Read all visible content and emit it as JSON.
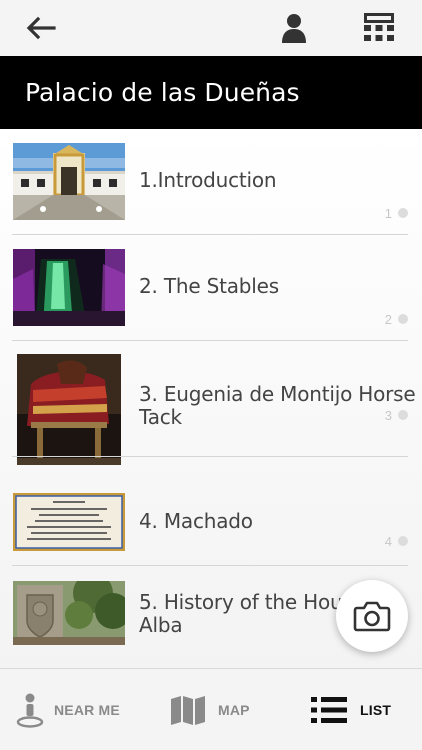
{
  "header": {
    "back_icon": "arrow-left-icon",
    "profile_icon": "user-icon",
    "keypad_icon": "keypad-icon"
  },
  "title": "Palacio de las Dueñas",
  "stops": [
    {
      "label": "1.Introduction",
      "number": "1",
      "thumb": "courtyard-gate"
    },
    {
      "label": "2. The Stables",
      "number": "2",
      "thumb": "green-lit-stables"
    },
    {
      "label": "3. Eugenia de Montijo Horse Tack",
      "number": "3",
      "thumb": "saddle"
    },
    {
      "label": "4. Machado",
      "number": "4",
      "thumb": "ceramic-plaque"
    },
    {
      "label": "5. History of the House of Alba",
      "number": "5",
      "thumb": "coat-of-arms-garden"
    }
  ],
  "fab": {
    "icon": "camera-icon"
  },
  "nav": {
    "near_me": "NEAR ME",
    "map": "MAP",
    "list": "LIST",
    "active": "list"
  },
  "colors": {
    "title_bar_bg": "#000000",
    "active_nav": "#111111",
    "inactive_nav": "#8a8a8a"
  }
}
